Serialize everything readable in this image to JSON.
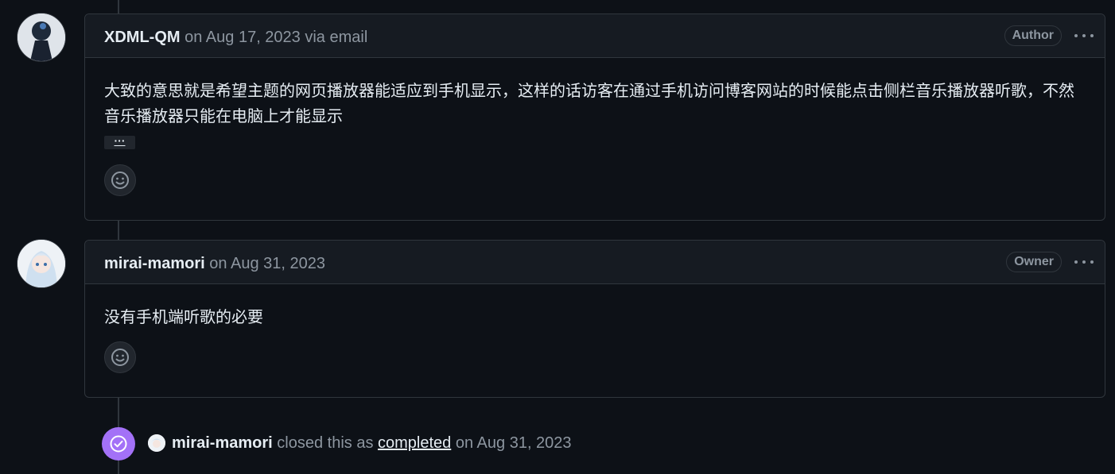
{
  "comments": [
    {
      "author": "XDML-QM",
      "meta": " on Aug 17, 2023 via email",
      "role_badge": "Author",
      "body": "大致的意思就是希望主题的网页播放器能适应到手机显示，这样的话访客在通过手机访问博客网站的时候能点击侧栏音乐播放器听歌，不然音乐播放器只能在电脑上才能显示",
      "collapsed_label": "···"
    },
    {
      "author": "mirai-mamori",
      "meta": " on Aug 31, 2023",
      "role_badge": "Owner",
      "body": "没有手机端听歌的必要"
    }
  ],
  "event": {
    "actor": "mirai-mamori",
    "action": " closed this as ",
    "state_link": "completed",
    "date": " on Aug 31, 2023"
  },
  "icons": {
    "kebab": "kebab-horizontal-icon",
    "reaction": "smiley-icon",
    "event": "check-circle-icon"
  },
  "colors": {
    "background": "#0d1117",
    "header_bg": "#161b22",
    "border": "#30363d",
    "muted": "#8d96a0",
    "text": "#e6edf3",
    "closed_purple": "#a371f7"
  }
}
